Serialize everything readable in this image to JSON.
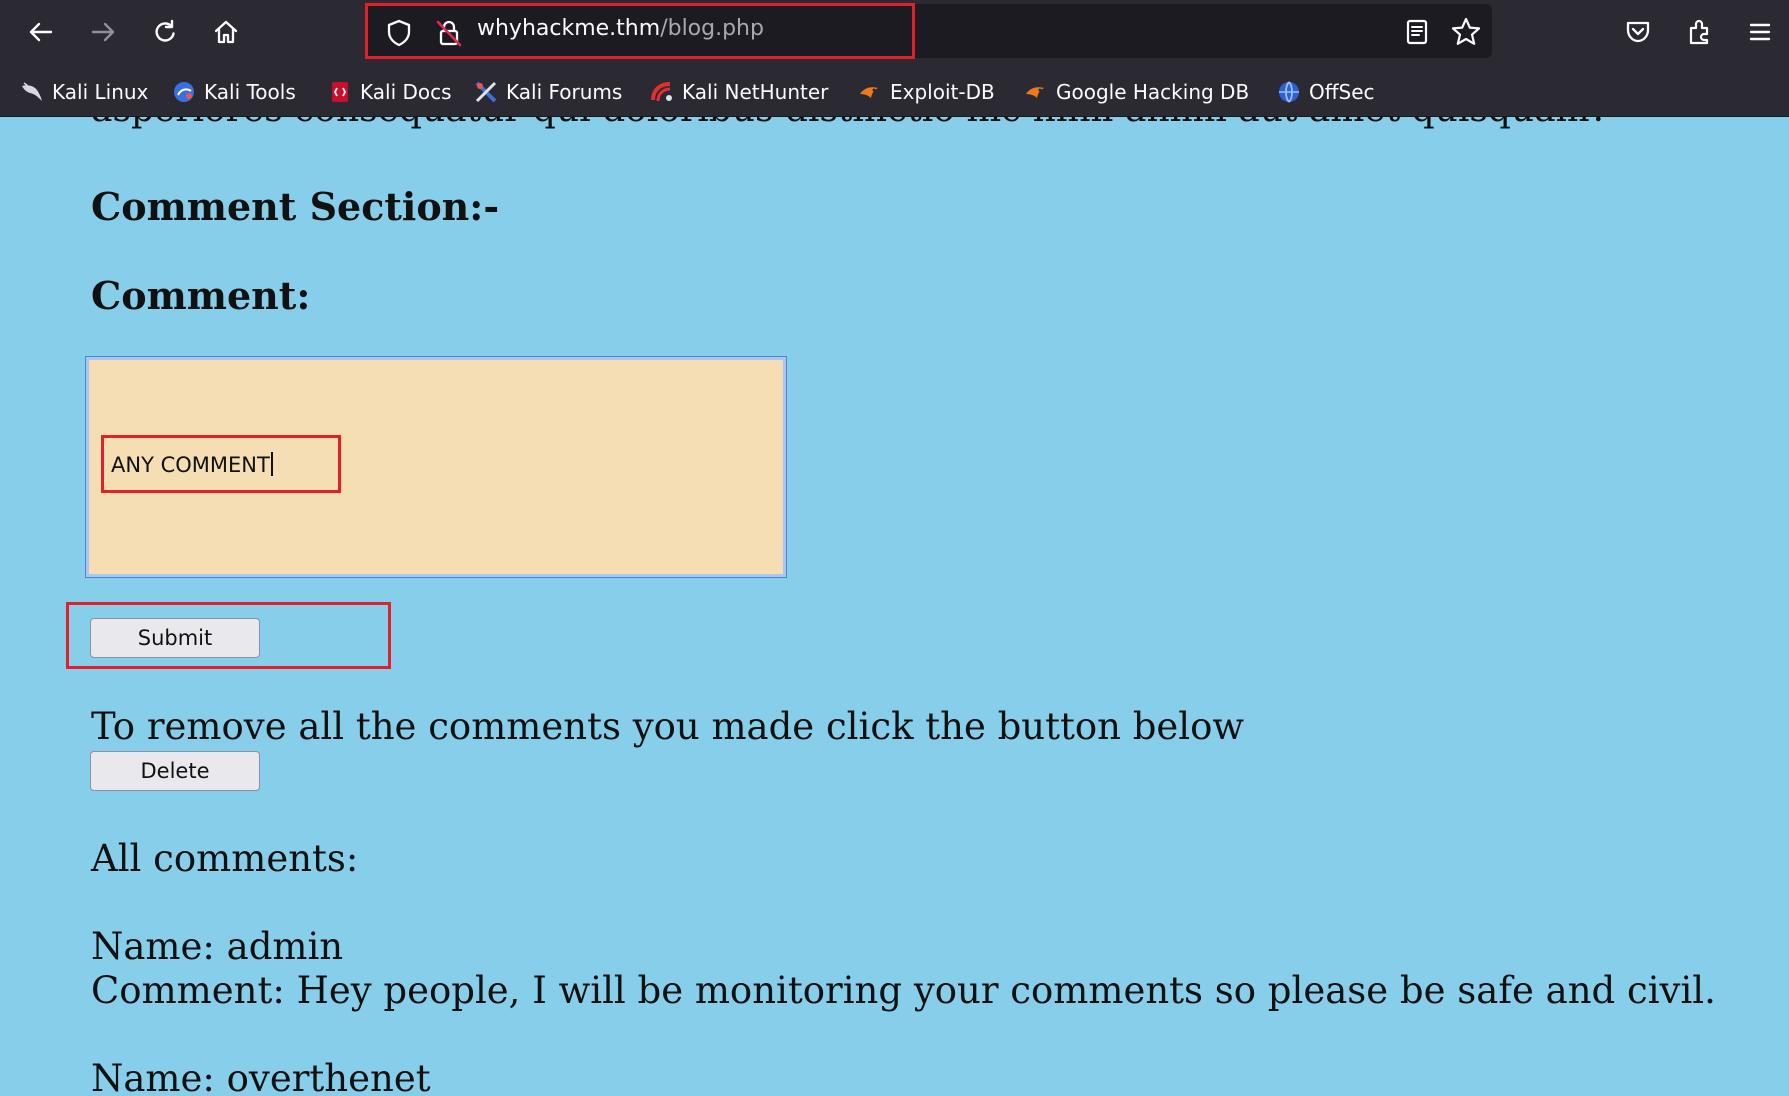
{
  "browser": {
    "url_host": "whyhackme.thm",
    "url_path": "/blog.php",
    "bookmarks": [
      {
        "label": "Kali Linux",
        "icon": "kali-dragon-icon"
      },
      {
        "label": "Kali Tools",
        "icon": "kali-tools-icon"
      },
      {
        "label": "Kali Docs",
        "icon": "kali-docs-icon"
      },
      {
        "label": "Kali Forums",
        "icon": "kali-forums-icon"
      },
      {
        "label": "Kali NetHunter",
        "icon": "nethunter-icon"
      },
      {
        "label": "Exploit-DB",
        "icon": "exploit-db-icon"
      },
      {
        "label": "Google Hacking DB",
        "icon": "ghdb-icon"
      },
      {
        "label": "OffSec",
        "icon": "offsec-icon"
      }
    ],
    "colors": {
      "chrome_bg": "#2b2a33",
      "urlbar_bg": "#1c1b22",
      "highlight": "#e0202a"
    }
  },
  "page": {
    "cut_text": "asperiores consequatur qui doloribus distinctio hic nihil animi aut amet quisquam?",
    "comment_section_heading": "Comment Section:-",
    "comment_label": "Comment:",
    "comment_value": "ANY COMMENT",
    "submit_label": "Submit",
    "remove_text": "To remove all the comments you made click the button below",
    "delete_label": "Delete",
    "all_comments_label": "All comments:",
    "comments": [
      {
        "name": "Name: admin",
        "comment": "Comment: Hey people, I will be monitoring your comments so please be safe and civil."
      },
      {
        "name": "Name: overthenet",
        "comment": ""
      }
    ],
    "colors": {
      "background": "#87ceeb",
      "textarea_bg": "#f5deb3"
    }
  }
}
